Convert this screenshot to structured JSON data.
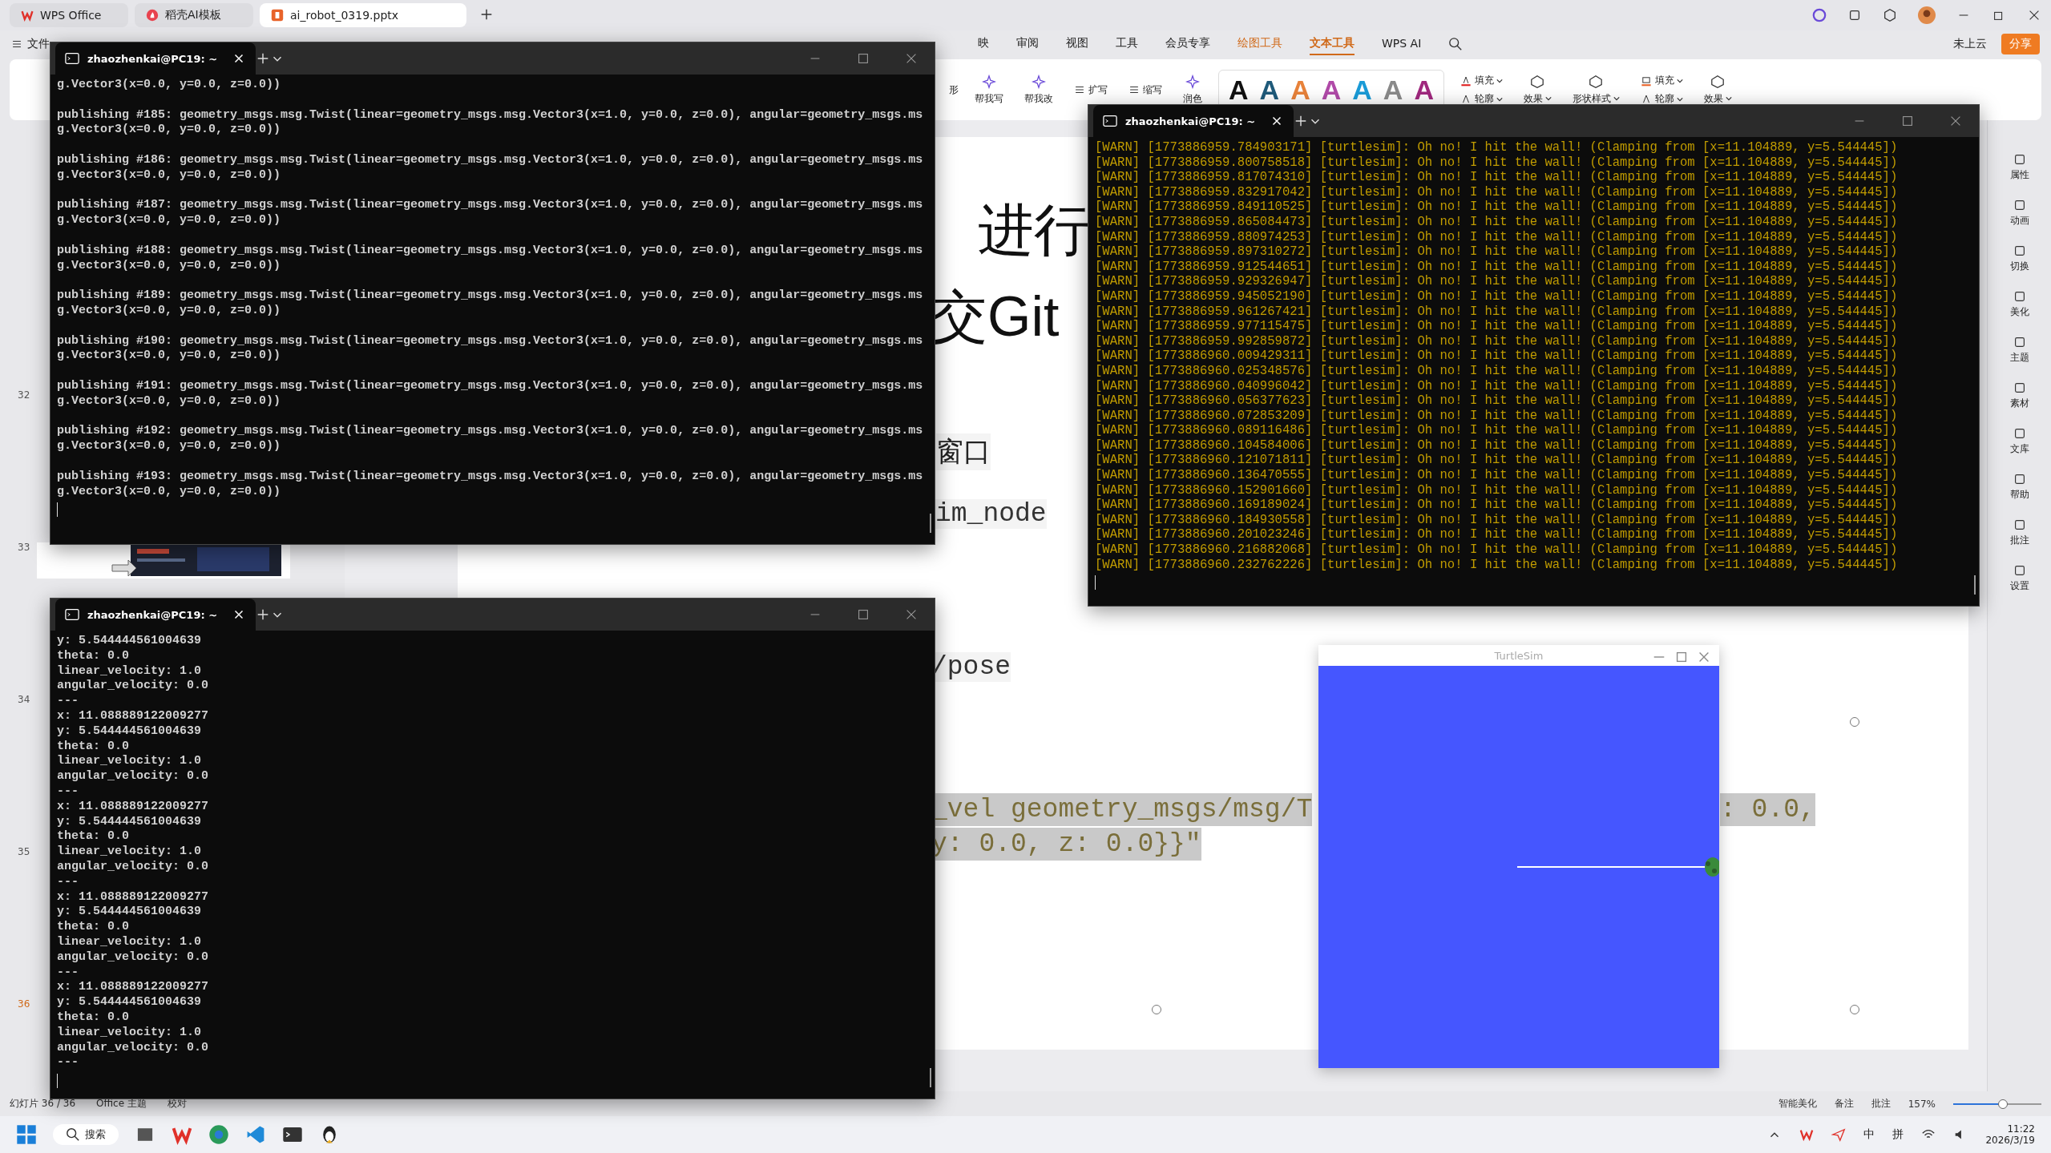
{
  "app_tabs": [
    {
      "label": "WPS Office",
      "selected": false,
      "kind": "wps"
    },
    {
      "label": "稻壳AI模板",
      "selected": false,
      "kind": "docer"
    },
    {
      "label": "ai_robot_0319.pptx",
      "selected": true,
      "kind": "ppt"
    }
  ],
  "menu": {
    "file": "文件",
    "items": [
      {
        "label": "映",
        "selected": false
      },
      {
        "label": "审阅",
        "selected": false
      },
      {
        "label": "视图",
        "selected": false
      },
      {
        "label": "工具",
        "selected": false
      },
      {
        "label": "会员专享",
        "selected": false
      },
      {
        "label": "绘图工具",
        "selected": false,
        "kind": "tool"
      },
      {
        "label": "文本工具",
        "selected": true,
        "kind": "tool"
      },
      {
        "label": "WPS AI",
        "selected": false,
        "kind": "ai"
      }
    ],
    "cloud": "未上云",
    "share": "分享"
  },
  "ribbon": {
    "items": [
      {
        "label": "形",
        "kind": "text"
      },
      {
        "label": "帮我写",
        "kind": "big"
      },
      {
        "label": "帮我改",
        "kind": "big"
      },
      {
        "label": "扩写",
        "kind": "small"
      },
      {
        "label": "缩写",
        "kind": "small"
      },
      {
        "label": "润色",
        "kind": "big"
      }
    ],
    "wordart": [
      {
        "glyph": "A",
        "color": "#111111"
      },
      {
        "glyph": "A",
        "color": "#1f5a7a"
      },
      {
        "glyph": "A",
        "color": "#e8823a"
      },
      {
        "glyph": "A",
        "color": "#b04aa8"
      },
      {
        "glyph": "A",
        "color": "#1a9bd7"
      },
      {
        "glyph": "A",
        "color": "#8a8a8a"
      },
      {
        "glyph": "A",
        "color": "#a0287e"
      }
    ],
    "format": [
      {
        "label": "填充",
        "kind": "fill"
      },
      {
        "label": "轮廓",
        "kind": "outline"
      },
      {
        "label": "效果",
        "kind": "big"
      },
      {
        "label": "形状样式",
        "kind": "big"
      },
      {
        "label": "填充",
        "kind": "shapefill"
      },
      {
        "label": "轮廓",
        "kind": "outline"
      },
      {
        "label": "效果",
        "kind": "big"
      }
    ]
  },
  "thumbnails": [
    {
      "number": "32",
      "selected": false
    },
    {
      "number": "33",
      "selected": false
    },
    {
      "number": "34",
      "selected": false
    },
    {
      "number": "35",
      "selected": false
    },
    {
      "number": "36",
      "selected": true
    }
  ],
  "slide": [
    {
      "text": "进行",
      "kind": "title"
    },
    {
      "text": "交Git",
      "kind": "title"
    },
    {
      "text": "窗口",
      "kind": "body"
    },
    {
      "text": "im_node",
      "kind": "code"
    },
    {
      "text": "/pose",
      "kind": "code"
    },
    {
      "text": "_vel geometry_msgs/msg/T",
      "kind": "highlight"
    },
    {
      "text": ": 0.0,",
      "kind": "highlight"
    },
    {
      "text": "y: 0.0, z: 0.0}}\"",
      "kind": "highlight"
    }
  ],
  "sidebar": [
    "属性",
    "动画",
    "切换",
    "美化",
    "主题",
    "素材",
    "文库",
    "帮助",
    "批注",
    "设置"
  ],
  "status": {
    "left": [
      "幻灯片 36 / 36",
      "Office 主题",
      "校对"
    ],
    "right": [
      "智能美化",
      "备注",
      "批注"
    ],
    "zoom": "157%",
    "level": 0.55
  },
  "terminals": [
    {
      "title": "zhaozhenkai@PC19: ~",
      "kind": "plain",
      "spaced": true,
      "lines": [
        "g.Vector3(x=0.0, y=0.0, z=0.0))",
        "publishing #185: geometry_msgs.msg.Twist(linear=geometry_msgs.msg.Vector3(x=1.0, y=0.0, z=0.0), angular=geometry_msgs.ms",
        "g.Vector3(x=0.0, y=0.0, z=0.0))",
        "publishing #186: geometry_msgs.msg.Twist(linear=geometry_msgs.msg.Vector3(x=1.0, y=0.0, z=0.0), angular=geometry_msgs.ms",
        "g.Vector3(x=0.0, y=0.0, z=0.0))",
        "publishing #187: geometry_msgs.msg.Twist(linear=geometry_msgs.msg.Vector3(x=1.0, y=0.0, z=0.0), angular=geometry_msgs.ms",
        "g.Vector3(x=0.0, y=0.0, z=0.0))",
        "publishing #188: geometry_msgs.msg.Twist(linear=geometry_msgs.msg.Vector3(x=1.0, y=0.0, z=0.0), angular=geometry_msgs.ms",
        "g.Vector3(x=0.0, y=0.0, z=0.0))",
        "publishing #189: geometry_msgs.msg.Twist(linear=geometry_msgs.msg.Vector3(x=1.0, y=0.0, z=0.0), angular=geometry_msgs.ms",
        "g.Vector3(x=0.0, y=0.0, z=0.0))",
        "publishing #190: geometry_msgs.msg.Twist(linear=geometry_msgs.msg.Vector3(x=1.0, y=0.0, z=0.0), angular=geometry_msgs.ms",
        "g.Vector3(x=0.0, y=0.0, z=0.0))",
        "publishing #191: geometry_msgs.msg.Twist(linear=geometry_msgs.msg.Vector3(x=1.0, y=0.0, z=0.0), angular=geometry_msgs.ms",
        "g.Vector3(x=0.0, y=0.0, z=0.0))",
        "publishing #192: geometry_msgs.msg.Twist(linear=geometry_msgs.msg.Vector3(x=1.0, y=0.0, z=0.0), angular=geometry_msgs.ms",
        "g.Vector3(x=0.0, y=0.0, z=0.0))",
        "publishing #193: geometry_msgs.msg.Twist(linear=geometry_msgs.msg.Vector3(x=1.0, y=0.0, z=0.0), angular=geometry_msgs.ms",
        "g.Vector3(x=0.0, y=0.0, z=0.0))"
      ]
    },
    {
      "title": "zhaozhenkai@PC19: ~",
      "kind": "plain",
      "lines": [
        "y: 5.544444561004639",
        "theta: 0.0",
        "linear_velocity: 1.0",
        "angular_velocity: 0.0",
        "---",
        "x: 11.088889122009277",
        "y: 5.544444561004639",
        "theta: 0.0",
        "linear_velocity: 1.0",
        "angular_velocity: 0.0",
        "---",
        "x: 11.088889122009277",
        "y: 5.544444561004639",
        "theta: 0.0",
        "linear_velocity: 1.0",
        "angular_velocity: 0.0",
        "---",
        "x: 11.088889122009277",
        "y: 5.544444561004639",
        "theta: 0.0",
        "linear_velocity: 1.0",
        "angular_velocity: 0.0",
        "---",
        "x: 11.088889122009277",
        "y: 5.544444561004639",
        "theta: 0.0",
        "linear_velocity: 1.0",
        "angular_velocity: 0.0",
        "---"
      ]
    },
    {
      "title": "zhaozhenkai@PC19: ~",
      "kind": "warn",
      "lines": [
        "[WARN] [1773886959.784903171] [turtlesim]: Oh no! I hit the wall! (Clamping from [x=11.104889, y=5.544445])",
        "[WARN] [1773886959.800758518] [turtlesim]: Oh no! I hit the wall! (Clamping from [x=11.104889, y=5.544445])",
        "[WARN] [1773886959.817074310] [turtlesim]: Oh no! I hit the wall! (Clamping from [x=11.104889, y=5.544445])",
        "[WARN] [1773886959.832917042] [turtlesim]: Oh no! I hit the wall! (Clamping from [x=11.104889, y=5.544445])",
        "[WARN] [1773886959.849110525] [turtlesim]: Oh no! I hit the wall! (Clamping from [x=11.104889, y=5.544445])",
        "[WARN] [1773886959.865084473] [turtlesim]: Oh no! I hit the wall! (Clamping from [x=11.104889, y=5.544445])",
        "[WARN] [1773886959.880974253] [turtlesim]: Oh no! I hit the wall! (Clamping from [x=11.104889, y=5.544445])",
        "[WARN] [1773886959.897310272] [turtlesim]: Oh no! I hit the wall! (Clamping from [x=11.104889, y=5.544445])",
        "[WARN] [1773886959.912544651] [turtlesim]: Oh no! I hit the wall! (Clamping from [x=11.104889, y=5.544445])",
        "[WARN] [1773886959.929326947] [turtlesim]: Oh no! I hit the wall! (Clamping from [x=11.104889, y=5.544445])",
        "[WARN] [1773886959.945052190] [turtlesim]: Oh no! I hit the wall! (Clamping from [x=11.104889, y=5.544445])",
        "[WARN] [1773886959.961267421] [turtlesim]: Oh no! I hit the wall! (Clamping from [x=11.104889, y=5.544445])",
        "[WARN] [1773886959.977115475] [turtlesim]: Oh no! I hit the wall! (Clamping from [x=11.104889, y=5.544445])",
        "[WARN] [1773886959.992859872] [turtlesim]: Oh no! I hit the wall! (Clamping from [x=11.104889, y=5.544445])",
        "[WARN] [1773886960.009429311] [turtlesim]: Oh no! I hit the wall! (Clamping from [x=11.104889, y=5.544445])",
        "[WARN] [1773886960.025348576] [turtlesim]: Oh no! I hit the wall! (Clamping from [x=11.104889, y=5.544445])",
        "[WARN] [1773886960.040996042] [turtlesim]: Oh no! I hit the wall! (Clamping from [x=11.104889, y=5.544445])",
        "[WARN] [1773886960.056377623] [turtlesim]: Oh no! I hit the wall! (Clamping from [x=11.104889, y=5.544445])",
        "[WARN] [1773886960.072853209] [turtlesim]: Oh no! I hit the wall! (Clamping from [x=11.104889, y=5.544445])",
        "[WARN] [1773886960.089116486] [turtlesim]: Oh no! I hit the wall! (Clamping from [x=11.104889, y=5.544445])",
        "[WARN] [1773886960.104584006] [turtlesim]: Oh no! I hit the wall! (Clamping from [x=11.104889, y=5.544445])",
        "[WARN] [1773886960.121071811] [turtlesim]: Oh no! I hit the wall! (Clamping from [x=11.104889, y=5.544445])",
        "[WARN] [1773886960.136470555] [turtlesim]: Oh no! I hit the wall! (Clamping from [x=11.104889, y=5.544445])",
        "[WARN] [1773886960.152901660] [turtlesim]: Oh no! I hit the wall! (Clamping from [x=11.104889, y=5.544445])",
        "[WARN] [1773886960.169189024] [turtlesim]: Oh no! I hit the wall! (Clamping from [x=11.104889, y=5.544445])",
        "[WARN] [1773886960.184930558] [turtlesim]: Oh no! I hit the wall! (Clamping from [x=11.104889, y=5.544445])",
        "[WARN] [1773886960.201023246] [turtlesim]: Oh no! I hit the wall! (Clamping from [x=11.104889, y=5.544445])",
        "[WARN] [1773886960.216882068] [turtlesim]: Oh no! I hit the wall! (Clamping from [x=11.104889, y=5.544445])",
        "[WARN] [1773886960.232762226] [turtlesim]: Oh no! I hit the wall! (Clamping from [x=11.104889, y=5.544445])"
      ]
    }
  ],
  "turtlesim": {
    "title": "TurtleSim"
  },
  "taskbar": {
    "search": "搜索",
    "ime": "中",
    "input_mode": "拼",
    "time": "11:22",
    "date": "2026/3/19"
  }
}
